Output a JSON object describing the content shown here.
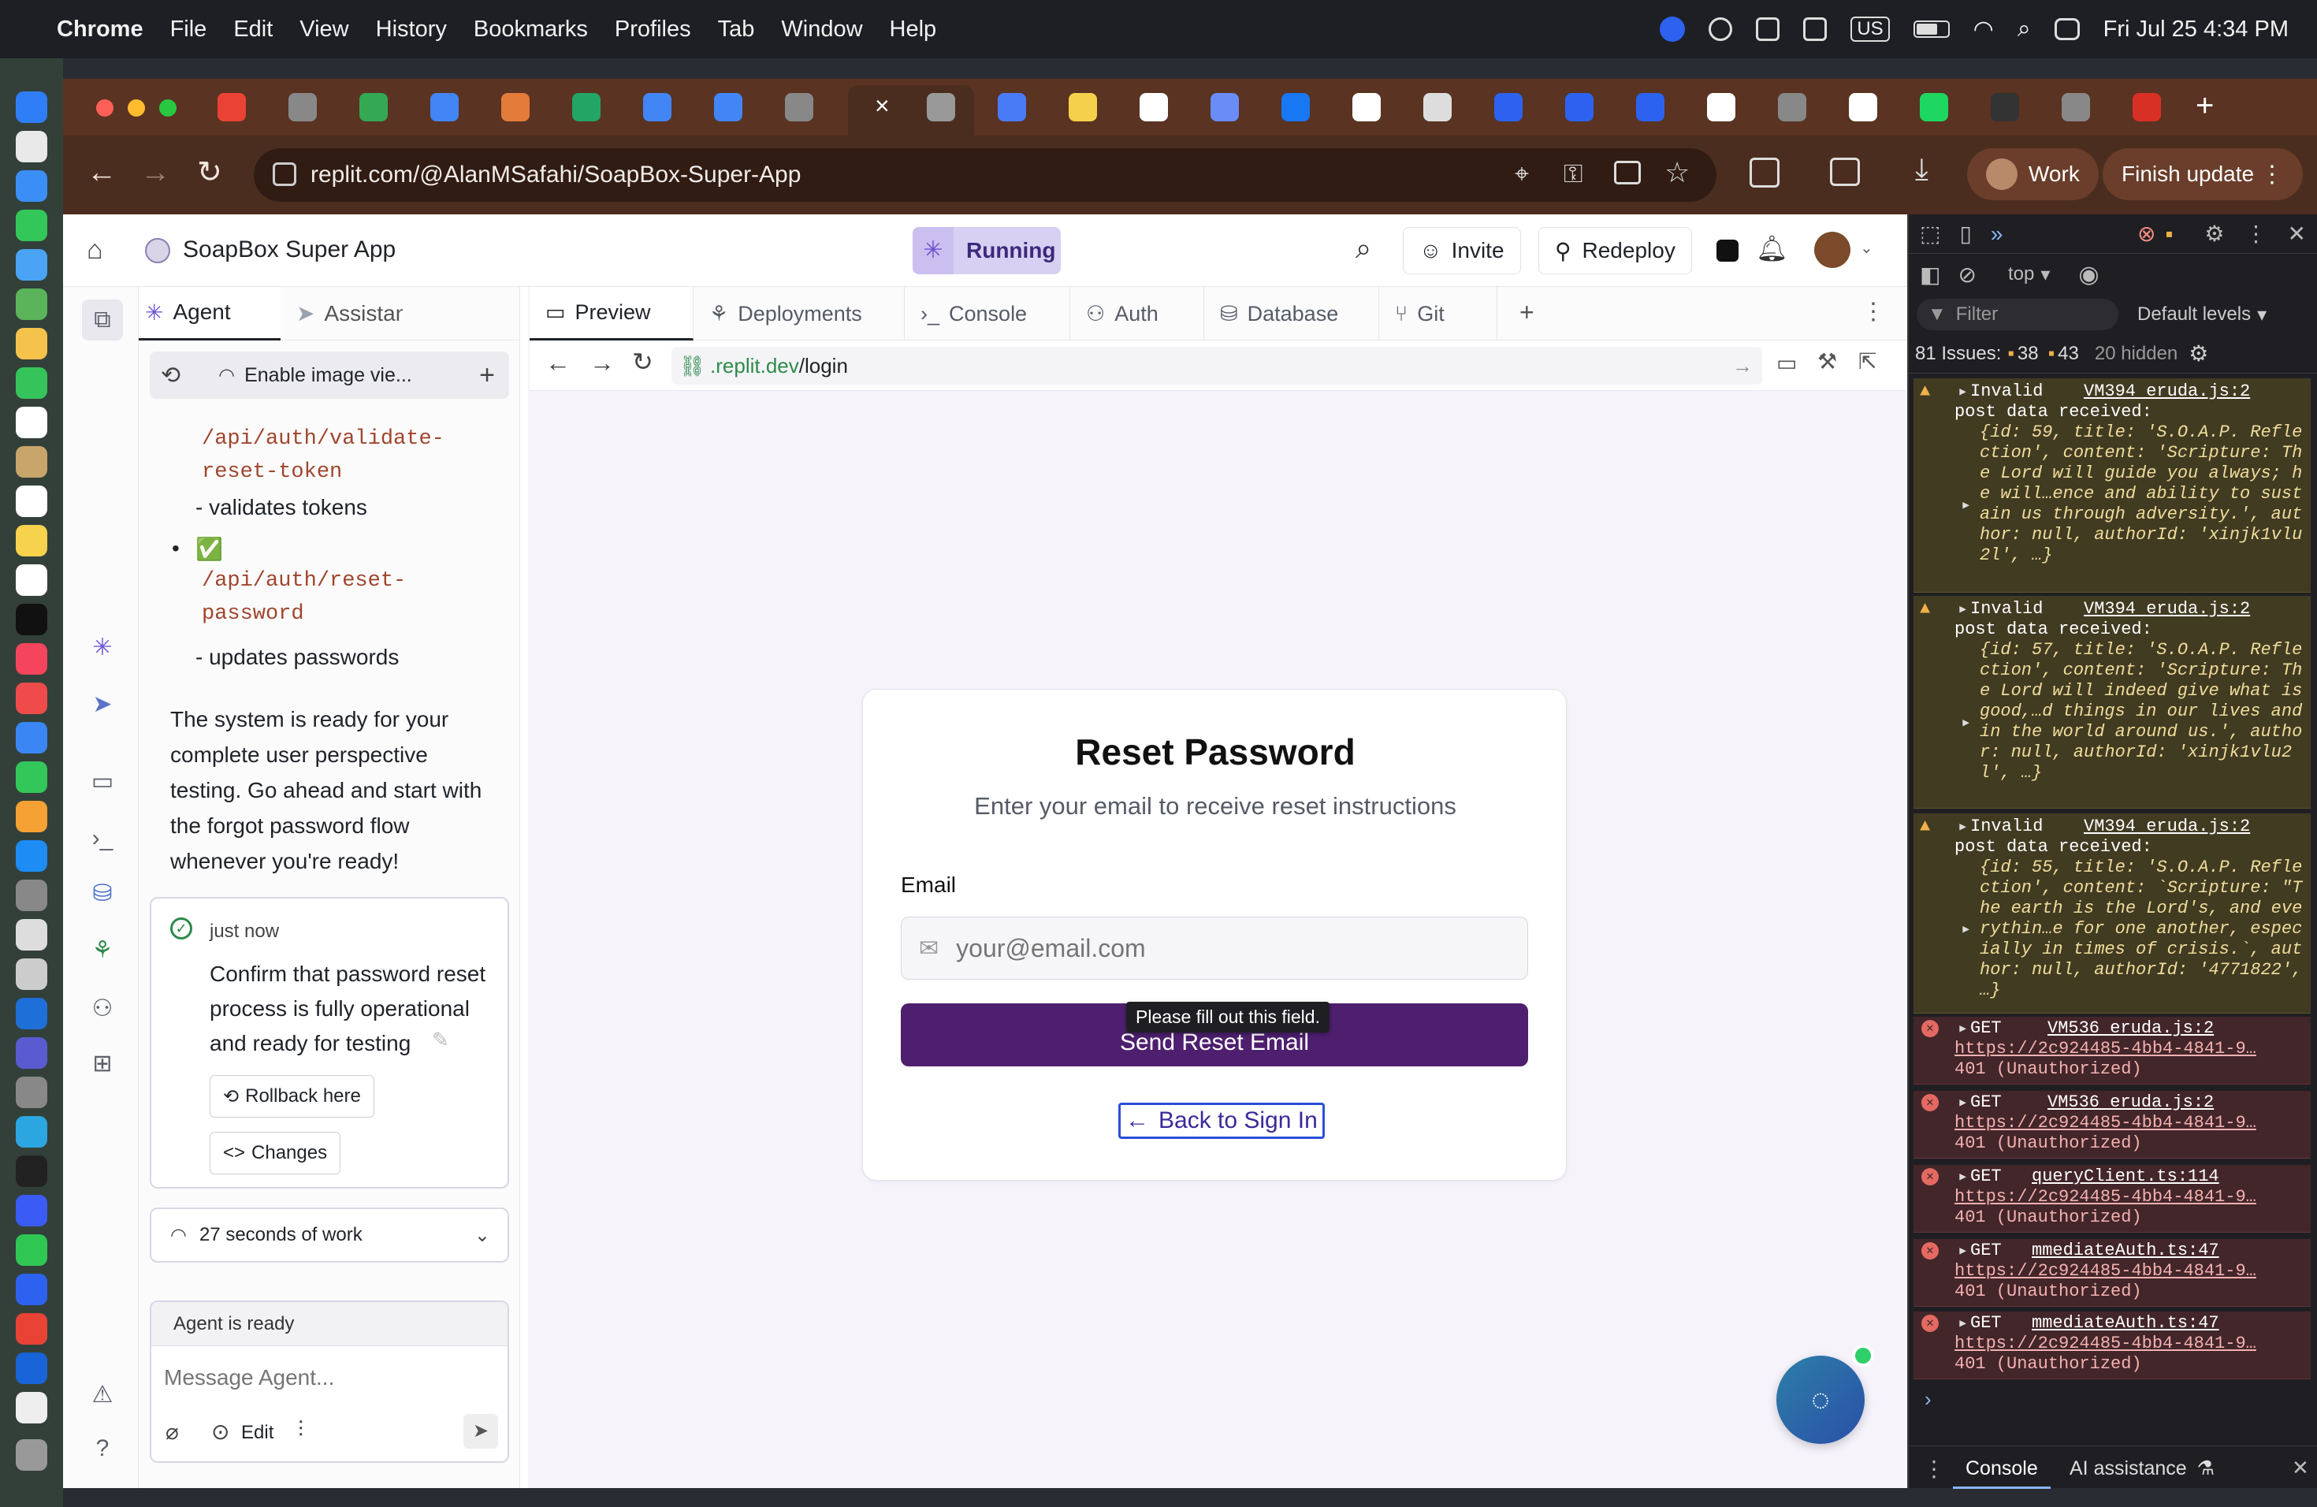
{
  "menubar": {
    "app": "Chrome",
    "items": [
      "File",
      "Edit",
      "View",
      "History",
      "Bookmarks",
      "Profiles",
      "Tab",
      "Window",
      "Help"
    ],
    "keyboard": "US",
    "datetime": "Fri Jul 25  4:34 PM"
  },
  "browser": {
    "url": "replit.com/@AlanMSafahi/SoapBox-Super-App",
    "profile": "Work",
    "update_button": "Finish update"
  },
  "replit": {
    "project_name": "SoapBox Super App",
    "status": "Running",
    "invite": "Invite",
    "redeploy": "Redeploy"
  },
  "agent": {
    "tabs": [
      "Agent",
      "Assistant"
    ],
    "toolbar_label": "Enable image vie...",
    "code1": "/api/auth/validate-\nreset-token",
    "text1": "- validates tokens",
    "check": "✅",
    "code2": "/api/auth/reset-\npassword",
    "text2": "- updates passwords",
    "message": "The system is ready for your complete user perspective testing. Go ahead and start with the forgot password flow whenever you're ready!",
    "checkpoint_time": "just now",
    "checkpoint_text": "Confirm that password reset process is fully operational and ready for testing",
    "rollback": "Rollback here",
    "changes": "Changes",
    "work_time": "27 seconds of work",
    "status": "Agent is ready",
    "placeholder": "Message Agent...",
    "edit": "Edit"
  },
  "preview_tabs": [
    "Preview",
    "Deployments",
    "Console",
    "Auth",
    "Database",
    "Git"
  ],
  "preview_url": {
    "host": ".replit.dev",
    "path": "/login"
  },
  "form": {
    "title": "Reset Password",
    "subtitle": "Enter your email to receive reset instructions",
    "email_label": "Email",
    "email_placeholder": "your@email.com",
    "tooltip": "Please fill out this field.",
    "submit": "Send Reset Email",
    "back": "Back to Sign In"
  },
  "devtools": {
    "context": "top",
    "filter": "Filter",
    "levels": "Default levels",
    "issues": "81 Issues:",
    "issue_warn": "38",
    "issue_info": "43",
    "hidden": "20 hidden",
    "warnings": [
      {
        "head": "Invalid",
        "src": "VM394 eruda.js:2",
        "line2": "post data received:",
        "body": "{id: 59, title: 'S.O.A.P. Reflection', content: 'Scripture: The Lord will guide you always; he will…ence and ability to sustain us through adversity.', author: null, authorId: 'xinjk1vlu2l', …}"
      },
      {
        "head": "Invalid",
        "src": "VM394 eruda.js:2",
        "line2": "post data received:",
        "body": "{id: 57, title: 'S.O.A.P. Reflection', content: 'Scripture: The Lord will indeed give what is good,…d things in our lives and in the world around us.', author: null, authorId: 'xinjk1vlu2l', …}"
      },
      {
        "head": "Invalid",
        "src": "VM394 eruda.js:2",
        "line2": "post data received:",
        "body": "{id: 55, title: 'S.O.A.P. Reflection', content: `Scripture: \"The earth is the Lord's, and everythin…e for one another, especially in times of crisis.`, author: null, authorId: '4771822', …}"
      }
    ],
    "errors": [
      {
        "method": "GET",
        "src": "VM536 eruda.js:2",
        "url": "https://2c924485-4bb4-4841-9…",
        "status": "401 (Unauthorized)"
      },
      {
        "method": "GET",
        "src": "VM536 eruda.js:2",
        "url": "https://2c924485-4bb4-4841-9…",
        "status": "401 (Unauthorized)"
      },
      {
        "method": "GET",
        "src": "queryClient.ts:114",
        "url": "https://2c924485-4bb4-4841-9…",
        "status": "401 (Unauthorized)"
      },
      {
        "method": "GET",
        "src": "mmediateAuth.ts:47",
        "url": "https://2c924485-4bb4-4841-9…",
        "status": "401 (Unauthorized)"
      },
      {
        "method": "GET",
        "src": "mmediateAuth.ts:47",
        "url": "https://2c924485-4bb4-4841-9…",
        "status": "401 (Unauthorized)"
      }
    ],
    "bottom_tabs": [
      "Console",
      "AI assistance"
    ]
  },
  "colors": {
    "accent_purple": "#5b2a86",
    "chrome_toolbar": "#4b2d1f",
    "devtools_bg": "#1f1f23"
  }
}
